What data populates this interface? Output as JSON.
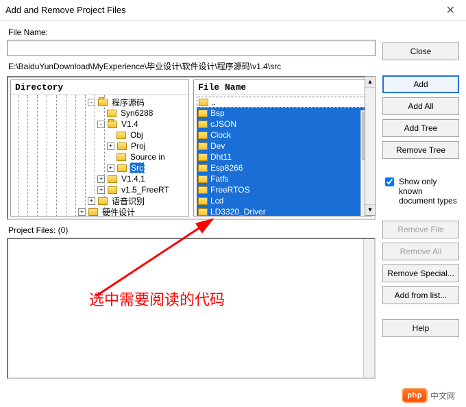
{
  "window": {
    "title": "Add and Remove Project Files"
  },
  "labels": {
    "file_name": "File Name:",
    "directory_header": "Directory",
    "filelist_header": "File Name",
    "project_files": "Project Files: (0)"
  },
  "filename_value": "",
  "path": "E:\\BaiduYunDownload\\MyExperience\\毕业设计\\软件设计\\程序源码\\v1.4\\src",
  "tree": [
    {
      "indent": 110,
      "exp": "-",
      "open": true,
      "label": "程序源码",
      "sel": false
    },
    {
      "indent": 138,
      "exp": "",
      "open": false,
      "label": "Syn6288",
      "sel": false
    },
    {
      "indent": 124,
      "exp": "-",
      "open": true,
      "label": "V1.4",
      "sel": false
    },
    {
      "indent": 152,
      "exp": "",
      "open": false,
      "label": "Obj",
      "sel": false
    },
    {
      "indent": 138,
      "exp": "+",
      "open": false,
      "label": "Proj",
      "sel": false
    },
    {
      "indent": 152,
      "exp": "",
      "open": false,
      "label": "Source in",
      "sel": false
    },
    {
      "indent": 138,
      "exp": "+",
      "open": false,
      "label": "Src",
      "sel": true
    },
    {
      "indent": 124,
      "exp": "+",
      "open": false,
      "label": "V1.4.1",
      "sel": false
    },
    {
      "indent": 124,
      "exp": "+",
      "open": false,
      "label": "v1.5_FreeRT",
      "sel": false
    },
    {
      "indent": 110,
      "exp": "+",
      "open": false,
      "label": "语音识别",
      "sel": false
    },
    {
      "indent": 96,
      "exp": "+",
      "open": false,
      "label": "硬件设计",
      "sel": false
    }
  ],
  "tree_vlines": [
    10,
    24,
    38,
    52,
    66,
    80,
    94,
    108,
    122,
    136
  ],
  "files_up": "..",
  "files": [
    "Bsp",
    "cJSON",
    "Clock",
    "Dev",
    "Dht11",
    "Esp8266",
    "Fatfs",
    "FreeRTOS",
    "Lcd",
    "LD3320_Driver"
  ],
  "buttons": {
    "close": "Close",
    "add": "Add",
    "add_all": "Add All",
    "add_tree": "Add Tree",
    "remove_tree": "Remove Tree",
    "remove_file": "Remove File",
    "remove_all": "Remove All",
    "remove_special": "Remove Special...",
    "add_from_list": "Add from list...",
    "help": "Help"
  },
  "checkbox": {
    "label": "Show only known document types",
    "checked": true
  },
  "annotation": "选中需要阅读的代码",
  "watermark": {
    "badge": "php",
    "text": "中文网"
  }
}
